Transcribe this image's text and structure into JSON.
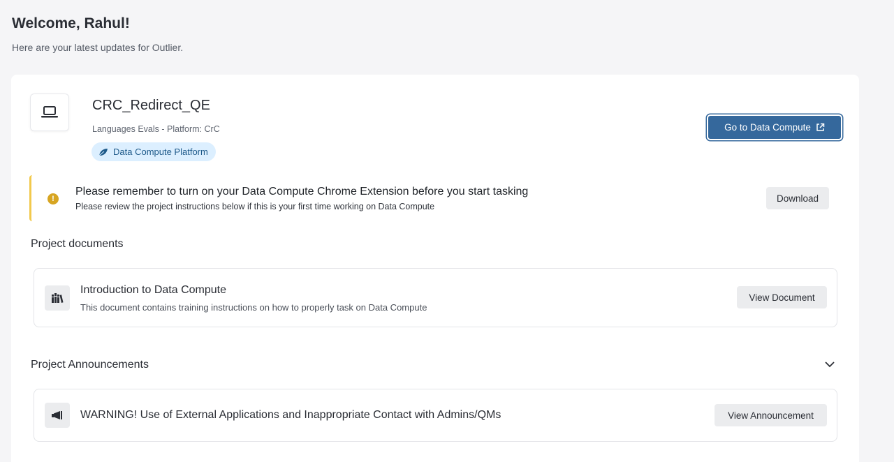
{
  "header": {
    "title": "Welcome, Rahul!",
    "subtitle": "Here are your latest updates for Outlier."
  },
  "project": {
    "icon": "laptop-icon",
    "name": "CRC_Redirect_QE",
    "subtitle": "Languages Evals - Platform: CrC",
    "badge": {
      "icon": "leaf-icon",
      "label": "Data Compute Platform"
    },
    "primary_button": {
      "label": "Go to Data Compute",
      "icon": "external-link-icon"
    }
  },
  "alert": {
    "icon": "exclamation-icon",
    "title": "Please remember to turn on your Data Compute Chrome Extension before you start tasking",
    "subtitle": "Please review the project instructions below if this is your first time working on Data Compute",
    "button": "Download"
  },
  "documents": {
    "section_title": "Project documents",
    "items": [
      {
        "icon": "books-icon",
        "title": "Introduction to Data Compute",
        "description": "This document contains training instructions on how to properly task on Data Compute",
        "button": "View Document"
      }
    ]
  },
  "announcements": {
    "section_title": "Project Announcements",
    "toggle_icon": "chevron-down-icon",
    "items": [
      {
        "icon": "megaphone-icon",
        "title": "WARNING! Use of External Applications and Inappropriate Contact with Admins/QMs",
        "button": "View Announcement"
      }
    ]
  },
  "colors": {
    "primary": "#35689c",
    "badge_bg": "#dcefff",
    "alert_accent": "#f2c94c",
    "alert_icon": "#d7a521",
    "page_bg": "#f5f5f7"
  }
}
